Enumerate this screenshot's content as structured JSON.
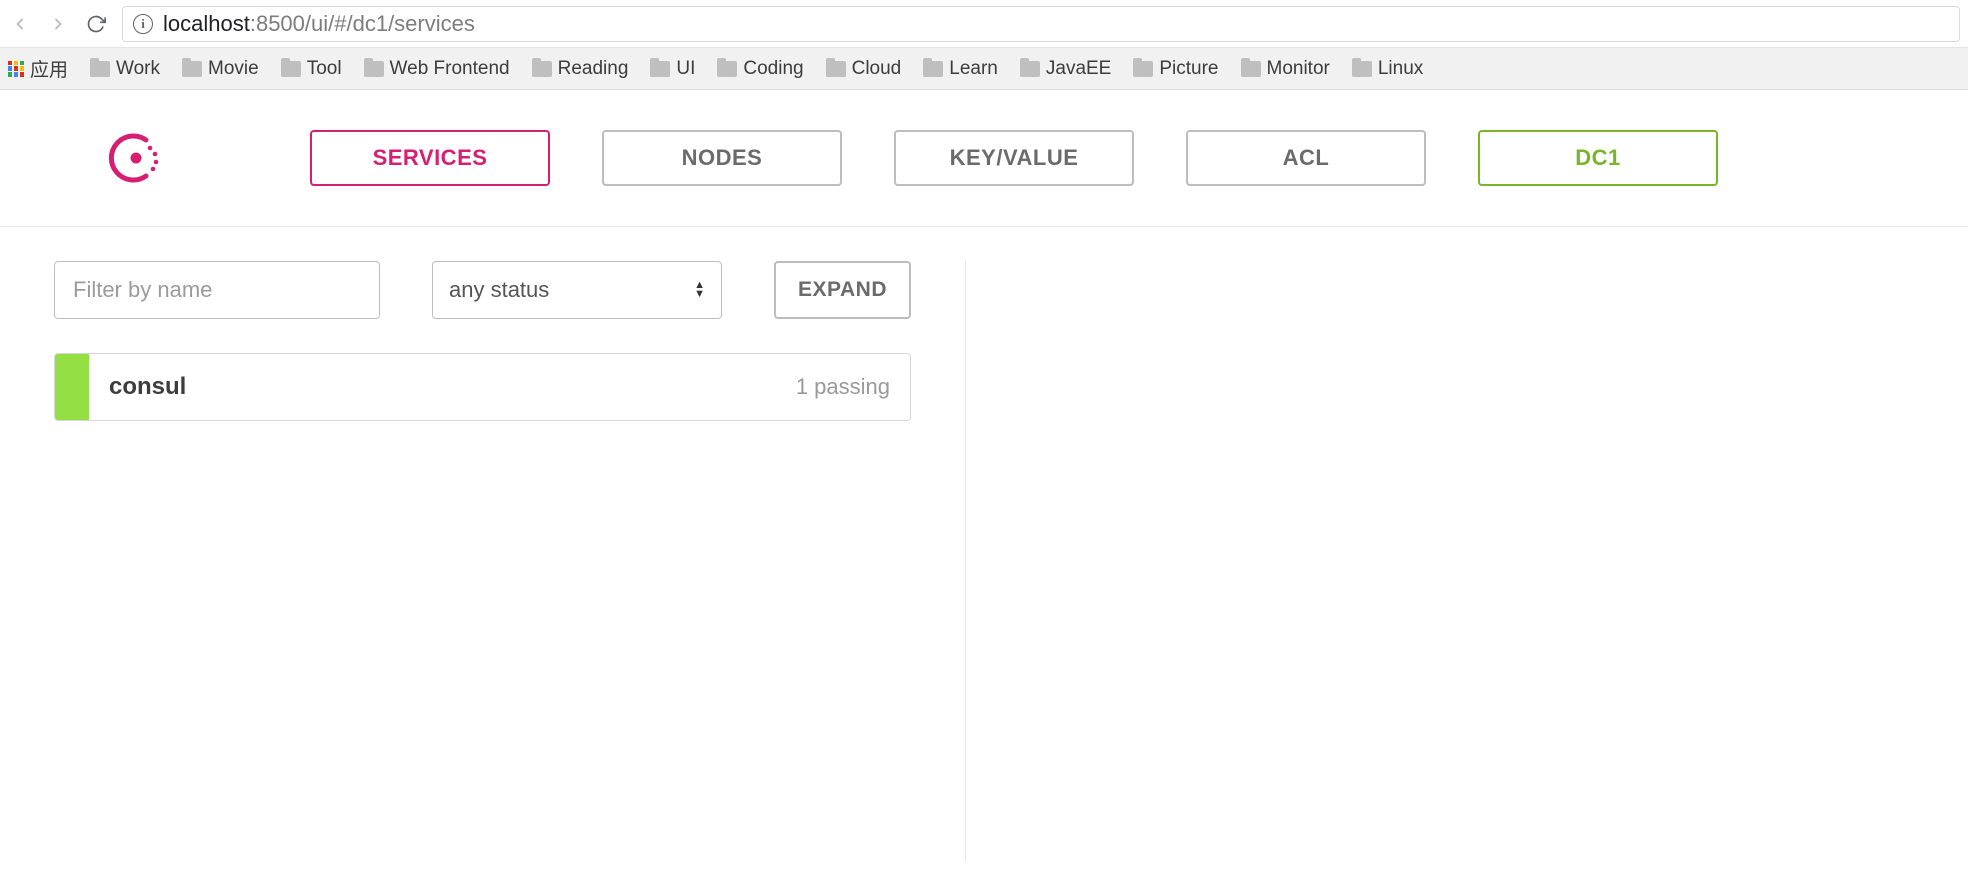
{
  "browser": {
    "url_host": "localhost",
    "url_rest": ":8500/ui/#/dc1/services"
  },
  "bookmarks": {
    "apps_label": "应用",
    "items": [
      {
        "label": "Work"
      },
      {
        "label": "Movie"
      },
      {
        "label": "Tool"
      },
      {
        "label": "Web Frontend"
      },
      {
        "label": "Reading"
      },
      {
        "label": "UI"
      },
      {
        "label": "Coding"
      },
      {
        "label": "Cloud"
      },
      {
        "label": "Learn"
      },
      {
        "label": "JavaEE"
      },
      {
        "label": "Picture"
      },
      {
        "label": "Monitor"
      },
      {
        "label": "Linux"
      }
    ]
  },
  "nav": {
    "tabs": [
      {
        "label": "SERVICES"
      },
      {
        "label": "NODES"
      },
      {
        "label": "KEY/VALUE"
      },
      {
        "label": "ACL"
      }
    ],
    "dc_label": "DC1"
  },
  "filters": {
    "name_placeholder": "Filter by name",
    "status_selected": "any status",
    "expand_label": "EXPAND"
  },
  "services": [
    {
      "name": "consul",
      "passing": "1 passing"
    }
  ],
  "colors": {
    "accent_pink": "#d61f73",
    "accent_green": "#79b52a",
    "status_green": "#94e044"
  }
}
